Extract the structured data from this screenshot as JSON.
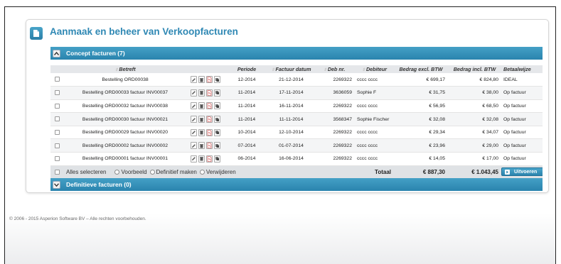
{
  "page": {
    "title": "Aanmaak en beheer van Verkoopfacturen"
  },
  "concept": {
    "header": "Concept facturen (7)",
    "columns": [
      "Betreft",
      "Periode",
      "Factuur datum",
      "Deb nr.",
      "Debiteur",
      "Bedrag excl. BTW",
      "Bedrag incl. BTW",
      "Betaalwijze"
    ],
    "rows": [
      [
        "Bestelling ORD00038",
        "12-2014",
        "21-12-2014",
        "2269322",
        "cccc cccc",
        "€ 699,17",
        "€ 824,80",
        "IDEAL"
      ],
      [
        "Bestelling ORD00033 factuur INV00037",
        "11-2014",
        "17-11-2014",
        "3636059",
        "Sophie F",
        "€ 31,75",
        "€ 38,00",
        "Op factuur"
      ],
      [
        "Bestelling ORD00032 factuur INV00038",
        "11-2014",
        "16-11-2014",
        "2269322",
        "cccc cccc",
        "€ 56,95",
        "€ 68,50",
        "Op factuur"
      ],
      [
        "Bestelling ORD00030 factuur INV00021",
        "11-2014",
        "11-11-2014",
        "3568347",
        "Sophie Fischer",
        "€ 32,08",
        "€ 32,08",
        "Op factuur"
      ],
      [
        "Bestelling ORD00029 factuur INV00020",
        "10-2014",
        "12-10-2014",
        "2269322",
        "cccc cccc",
        "€ 29,34",
        "€ 34,07",
        "Op factuur"
      ],
      [
        "Bestelling ORD00002 factuur INV00002",
        "07-2014",
        "01-07-2014",
        "2269322",
        "cccc cccc",
        "€ 23,96",
        "€ 29,00",
        "Op factuur"
      ],
      [
        "Bestelling ORD00001 factuur INV00001",
        "06-2014",
        "16-06-2014",
        "2269322",
        "cccc cccc",
        "€ 14,05",
        "€ 17,00",
        "Op factuur"
      ]
    ],
    "footer": {
      "select_all": "Alles selecteren",
      "opt_preview": "Voorbeeld",
      "opt_final": "Definitief maken",
      "opt_delete": "Verwijderen",
      "total_label": "Totaal",
      "total_excl": "€ 887,30",
      "total_incl": "€ 1.043,45",
      "run_button": "Uitvoeren"
    }
  },
  "definitive": {
    "header": "Definitieve facturen (0)"
  },
  "footer": {
    "copyright": "© 2006 - 2015 Asperion Software BV – Alle rechten voorbehouden."
  },
  "colors": {
    "accent": "#2f88b4",
    "header_bar": "#3793bd"
  },
  "icons": [
    "edit-icon",
    "delete-icon",
    "pdf-icon",
    "copy-icon",
    "collapse-icon",
    "expand-icon",
    "invoice-page-icon",
    "play-icon"
  ]
}
